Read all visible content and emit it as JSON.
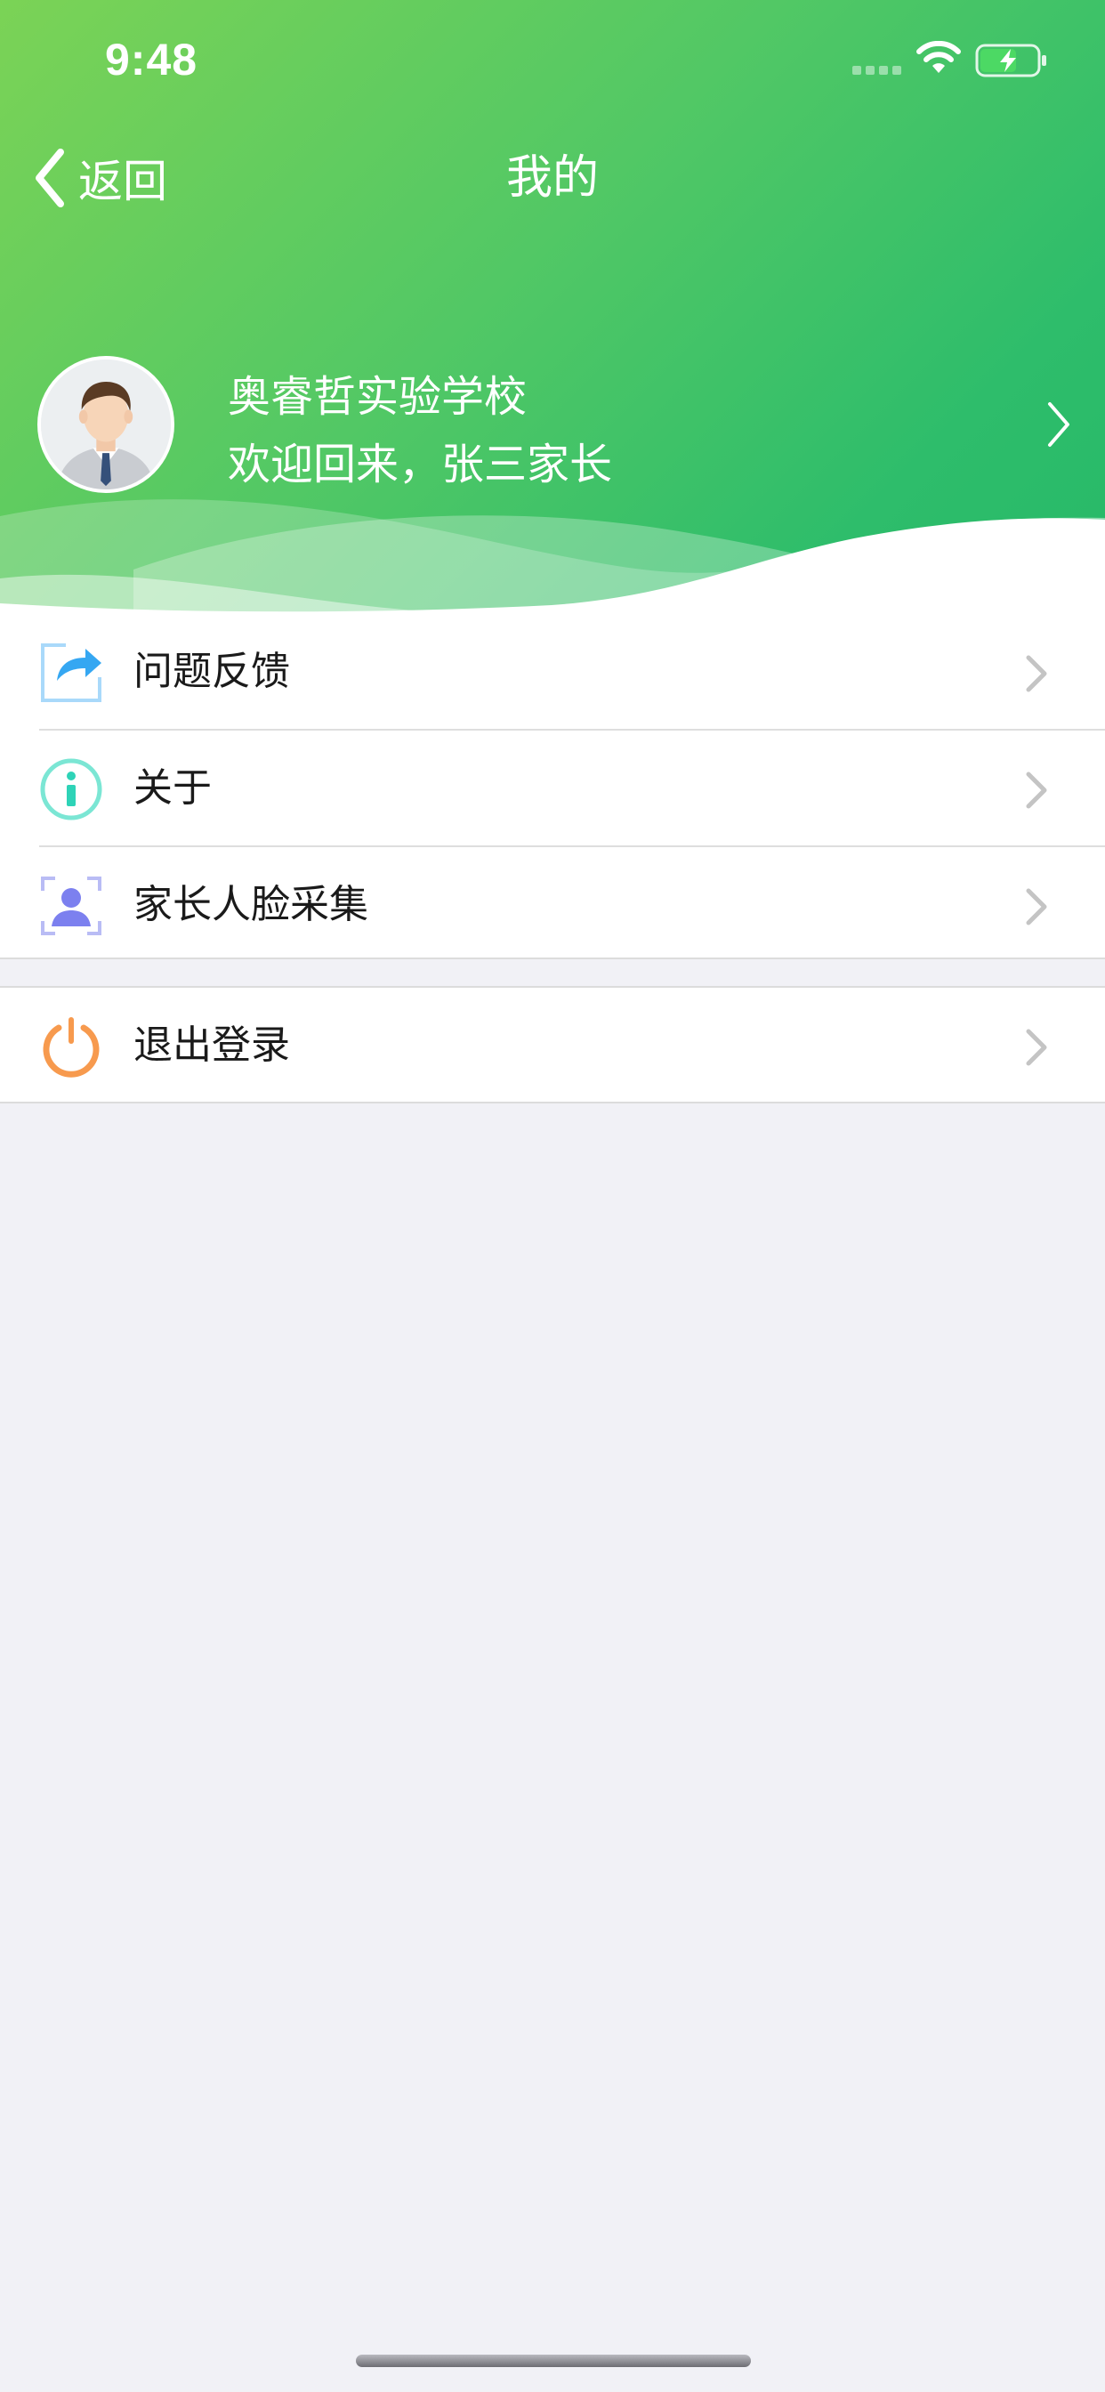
{
  "status_bar": {
    "time": "9:48",
    "signal_icon": "cellular-signal-icon",
    "wifi_icon": "wifi-icon",
    "battery_icon": "battery-charging-icon"
  },
  "nav": {
    "back_label": "返回",
    "back_icon": "chevron-left-icon",
    "title": "我的"
  },
  "profile": {
    "avatar_icon": "user-avatar-icon",
    "school_name": "奥睿哲实验学校",
    "welcome_text": "欢迎回来，张三家长",
    "chevron_icon": "chevron-right-icon"
  },
  "menu_group_1": [
    {
      "label": "问题反馈",
      "icon": "share-feedback-icon",
      "icon_color": "#35a7f2"
    },
    {
      "label": "关于",
      "icon": "info-icon",
      "icon_color": "#3cd9c1"
    },
    {
      "label": "家长人脸采集",
      "icon": "face-capture-icon",
      "icon_color": "#8083f0"
    }
  ],
  "menu_group_2": [
    {
      "label": "退出登录",
      "icon": "power-icon",
      "icon_color": "#f79a4e"
    }
  ],
  "colors": {
    "header_gradient_start": "#7bd356",
    "header_gradient_end": "#27b968",
    "background": "#f1f1f6",
    "text_primary": "#1a1a1a",
    "chevron": "#c4c4c4"
  }
}
